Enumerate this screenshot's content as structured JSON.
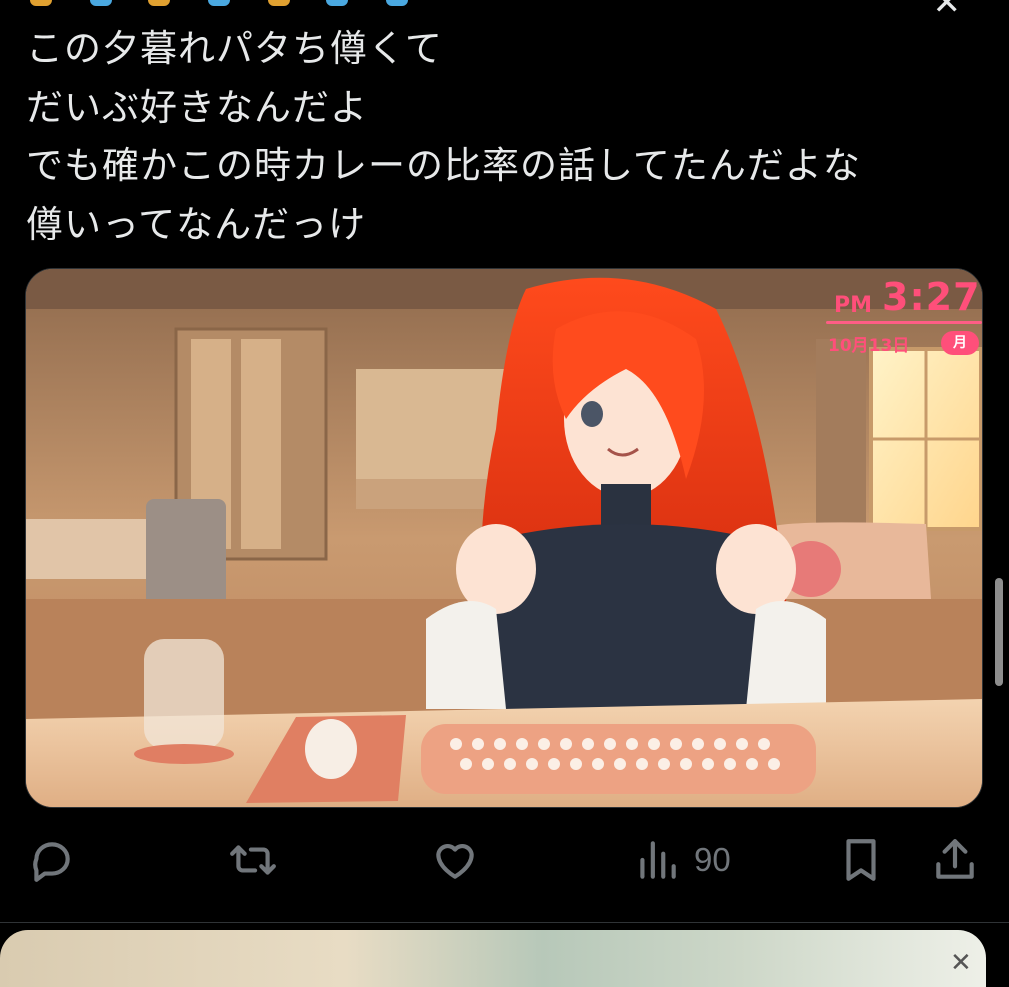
{
  "tweet": {
    "lines": [
      "この夕暮れパタち僔くて",
      "だいぶ好きなんだよ",
      "でも確かこの時カレーの比率の話してたんだよな",
      "僔いってなんだっけ"
    ]
  },
  "media": {
    "clock": {
      "ampm": "PM",
      "time": "3:27",
      "date": "10月13日",
      "day": "月"
    }
  },
  "actions": {
    "reply_icon": "reply-icon",
    "retweet_icon": "retweet-icon",
    "like_icon": "heart-icon",
    "views_icon": "views-icon",
    "views_count": "90",
    "bookmark_icon": "bookmark-icon",
    "share_icon": "share-icon"
  },
  "colors": {
    "background": "#000000",
    "text": "#e7e9ea",
    "icon": "#71767b",
    "clock_accent": "#ff4f7a"
  }
}
